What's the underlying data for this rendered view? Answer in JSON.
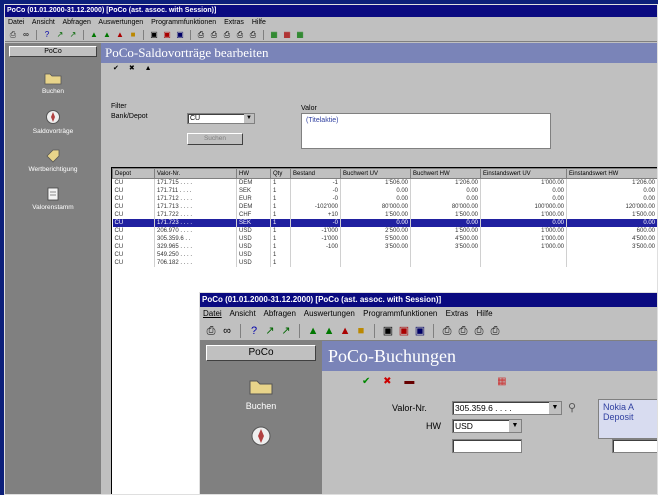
{
  "back_window": {
    "title": "PoCo (01.01.2000-31.12.2000) [PoCo (ast. assoc. with Session)]",
    "menu": [
      "Datei",
      "Ansicht",
      "Abfragen",
      "Auswertungen",
      "Programmfunktionen",
      "Extras",
      "Hilfe"
    ],
    "sidebar": {
      "header": "PoCo",
      "items": [
        {
          "label": "Buchen",
          "icon": "folder-icon"
        },
        {
          "label": "Saldovorträge",
          "icon": "compass-icon"
        },
        {
          "label": "Wertberichtigung",
          "icon": "tag-icon"
        },
        {
          "label": "Valorenstamm",
          "icon": "document-icon"
        }
      ]
    },
    "page_title": "PoCo-Saldovorträge bearbeiten",
    "actions": [
      "✔",
      "✖",
      "▲"
    ],
    "filter": {
      "label": "Filter",
      "field_label": "Bank/Depot",
      "field_value": "CU",
      "apply": "Suchen"
    },
    "valor": {
      "label": "Valor",
      "value": "(Titelaktie)"
    },
    "columns": [
      "Depot",
      "Valor-Nr.",
      "HW",
      "Qty",
      "Bestand",
      "Buchwert UV",
      "Buchwert HW",
      "Einstandswert UV",
      "Einstandswert HW"
    ],
    "rows": [
      [
        "CU",
        "171.715 . . . .",
        "DEM",
        "1",
        "-1",
        "1'506.00",
        "1'206.00",
        "1'000.00",
        "1'206.00"
      ],
      [
        "CU",
        "171.711 . . . .",
        "SEK",
        "1",
        "-0",
        "0.00",
        "0.00",
        "0.00",
        "0.00"
      ],
      [
        "CU",
        "171.712 . . . .",
        "EUR",
        "1",
        "-0",
        "0.00",
        "0.00",
        "0.00",
        "0.00"
      ],
      [
        "CU",
        "171.713 . . . .",
        "DEM",
        "1",
        "-102'000",
        "80'000.00",
        "80'000.00",
        "100'000.00",
        "120'000.00"
      ],
      [
        "CU",
        "171.722 . . . .",
        "CHF",
        "1",
        "+10",
        "1'500.00",
        "1'500.00",
        "1'000.00",
        "1'500.00"
      ],
      [
        "CU",
        "171.723 . . . .",
        "SEK",
        "1",
        "-0",
        "0.00",
        "0.00",
        "0.00",
        "0.00"
      ],
      [
        "CU",
        "206.970 . . . .",
        "USD",
        "1",
        "-1'000",
        "2'500.00",
        "1'500.00",
        "1'000.00",
        "600.00"
      ],
      [
        "CU",
        "305.359.6 . .",
        "USD",
        "1",
        "-1'000",
        "5'500.00",
        "4'500.00",
        "1'000.00",
        "4'500.00"
      ],
      [
        "CU",
        "329.965 . . . .",
        "USD",
        "1",
        "-100",
        "3'500.00",
        "3'500.00",
        "1'000.00",
        "3'500.00"
      ],
      [
        "CU",
        "549.250 . . . .",
        "USD",
        "1",
        "",
        "",
        "",
        "",
        ""
      ],
      [
        "CU",
        "706.182 . . . .",
        "USD",
        "1",
        "",
        "",
        "",
        "",
        ""
      ]
    ],
    "selected_row_index": 5
  },
  "front_window": {
    "title": "PoCo (01.01.2000-31.12.2000) [PoCo (ast. assoc. with Session)]",
    "menu": [
      "Datei",
      "Ansicht",
      "Abfragen",
      "Auswertungen",
      "Programmfunktionen",
      "Extras",
      "Hilfe"
    ],
    "sidebar": {
      "header": "PoCo",
      "items": [
        {
          "label": "Buchen",
          "icon": "folder-icon"
        },
        {
          "label": "",
          "icon": "compass-icon"
        }
      ]
    },
    "page_title": "PoCo-Buchungen",
    "actions": [
      "✔",
      "✖",
      "▬"
    ],
    "valor_label": "Valor-Nr.",
    "valor_value": "305.359.6 . . . .",
    "hw_label": "HW",
    "hw_value": "USD",
    "info_line1": "Nokia A",
    "info_line2": "Deposit"
  },
  "colors": {
    "desktop": "#0c1f7a",
    "titlebar": "#0a0a80",
    "page_title_bar": "#7a84b8",
    "selection": "#2020a0",
    "sidebar": "#808080"
  }
}
